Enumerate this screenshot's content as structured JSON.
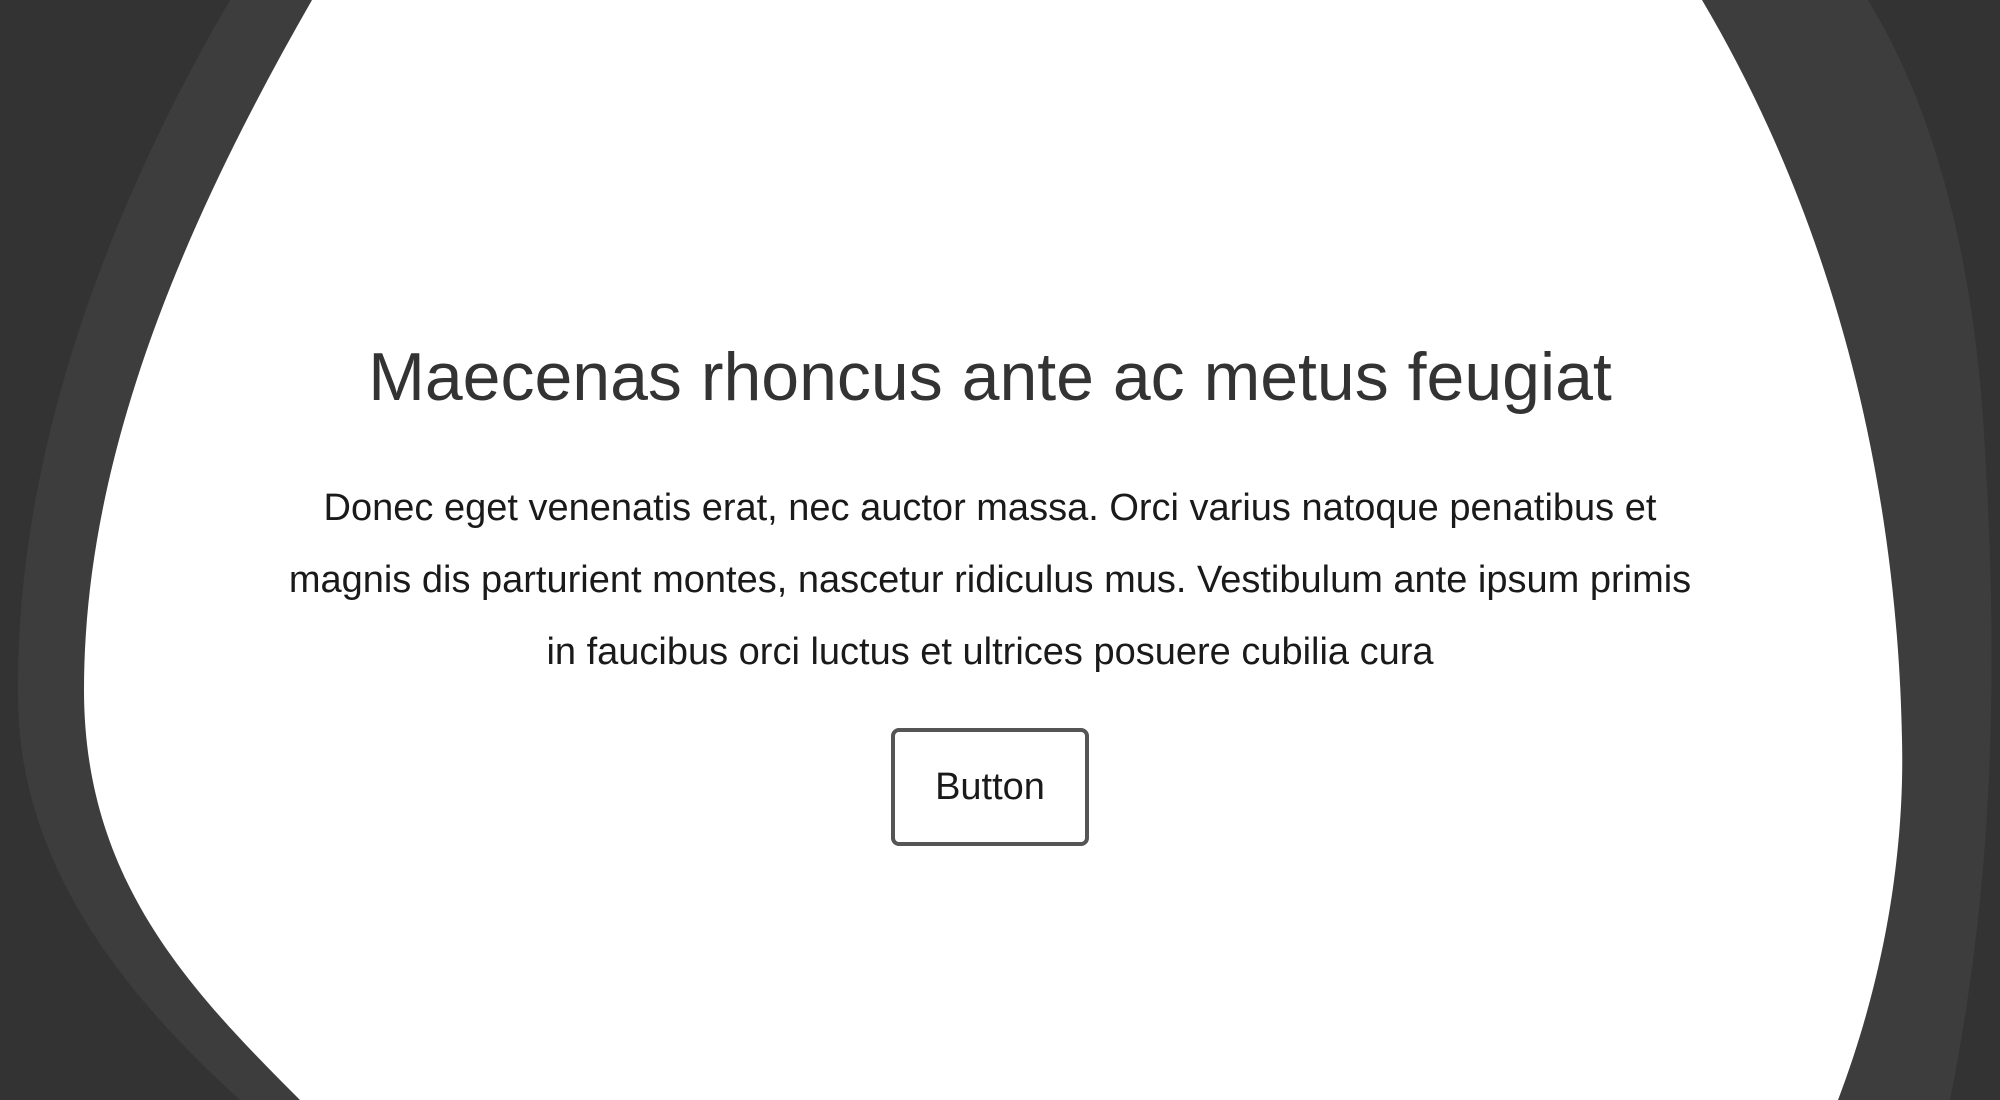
{
  "hero": {
    "title": "Maecenas rhoncus ante ac metus feugiat",
    "text": "Donec eget venenatis erat, nec auctor massa. Orci varius natoque penatibus et magnis dis parturient montes, nascetur ridiculus mus. Vestibulum ante ipsum primis in faucibus orci luctus et ultrices posuere cubilia cura",
    "button_label": "Button"
  },
  "colors": {
    "background_dark": "#333333",
    "background_band": "#3d3d3d",
    "panel": "#ffffff",
    "heading_text": "#333333",
    "body_text": "#1a1a1a",
    "button_border": "#555555"
  }
}
